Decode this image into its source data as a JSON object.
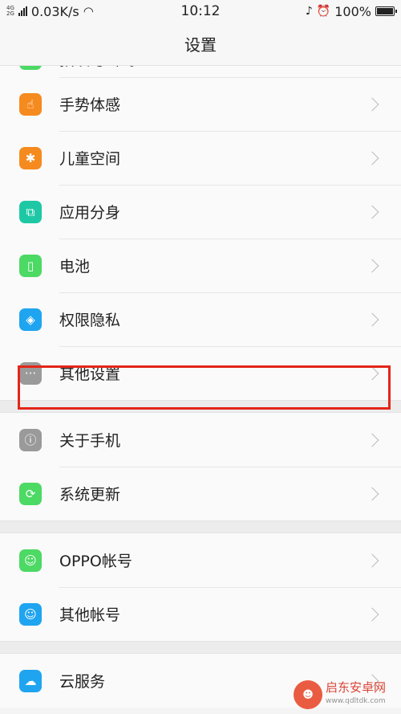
{
  "status": {
    "net_top": "4G",
    "net_bottom": "2G",
    "speed": "0.03K/s",
    "time": "10:12",
    "battery": "100%"
  },
  "nav": {
    "title": "设置"
  },
  "sections": [
    {
      "items": [
        {
          "label": "指纹与密码",
          "icon": "fingerprint-icon",
          "color": "#4cd964",
          "glyph": "◎",
          "partial": true
        },
        {
          "label": "手势体感",
          "icon": "hand-gesture-icon",
          "color": "#f58a1f",
          "glyph": "☝"
        },
        {
          "label": "儿童空间",
          "icon": "child-icon",
          "color": "#f58a1f",
          "glyph": "✱"
        },
        {
          "label": "应用分身",
          "icon": "app-clone-icon",
          "color": "#1ec8a5",
          "glyph": "⧉"
        },
        {
          "label": "电池",
          "icon": "battery-icon",
          "color": "#4cd964",
          "glyph": "▯"
        },
        {
          "label": "权限隐私",
          "icon": "privacy-shield-icon",
          "color": "#1fa4f0",
          "glyph": "◈"
        },
        {
          "label": "其他设置",
          "icon": "more-dots-icon",
          "color": "#9a9a9a",
          "glyph": "···"
        }
      ]
    },
    {
      "items": [
        {
          "label": "关于手机",
          "icon": "info-icon",
          "color": "#9a9a9a",
          "glyph": "ⓘ"
        },
        {
          "label": "系统更新",
          "icon": "system-update-icon",
          "color": "#4cd964",
          "glyph": "⟳"
        }
      ]
    },
    {
      "items": [
        {
          "label": "OPPO帐号",
          "icon": "user-icon",
          "color": "#4cd964",
          "glyph": "☺"
        },
        {
          "label": "其他帐号",
          "icon": "account-icon",
          "color": "#1fa4f0",
          "glyph": "☺"
        }
      ]
    },
    {
      "items": [
        {
          "label": "云服务",
          "icon": "cloud-icon",
          "color": "#1fa4f0",
          "glyph": "☁"
        }
      ]
    }
  ],
  "watermark": {
    "title": "启东安卓网",
    "url": "www.qdltdk.com"
  }
}
